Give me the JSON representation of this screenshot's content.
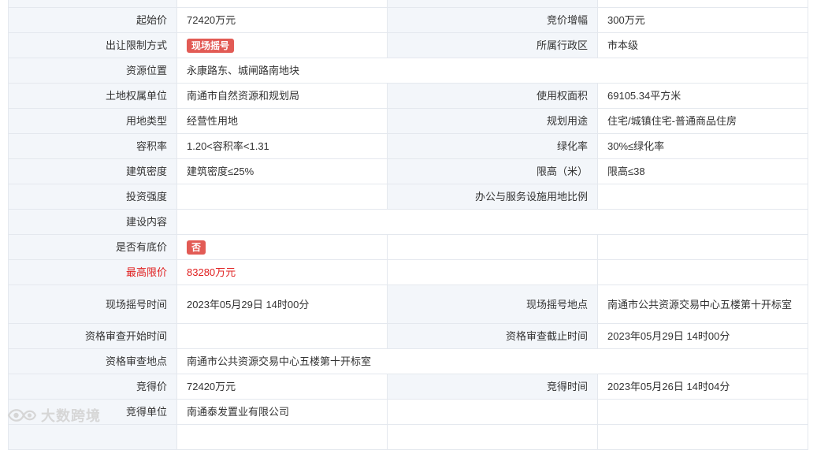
{
  "rows": [
    {
      "l1": "",
      "v1": "",
      "l2": "",
      "v2": ""
    },
    {
      "l1": "起始价",
      "v1": "72420万元",
      "l2": "竞价增幅",
      "v2": "300万元"
    },
    {
      "l1": "出让限制方式",
      "v1_tag": "现场摇号",
      "l2": "所属行政区",
      "v2": "市本级"
    },
    {
      "l1": "资源位置",
      "v1": "永康路东、城闸路南地块"
    },
    {
      "l1": "土地权属单位",
      "v1": "南通市自然资源和规划局",
      "l2": "使用权面积",
      "v2": "69105.34平方米"
    },
    {
      "l1": "用地类型",
      "v1": "经营性用地",
      "l2": "规划用途",
      "v2": "住宅/城镇住宅-普通商品住房"
    },
    {
      "l1": "容积率",
      "v1": "1.20<容积率<1.31",
      "l2": "绿化率",
      "v2": "30%≤绿化率"
    },
    {
      "l1": "建筑密度",
      "v1": "建筑密度≤25%",
      "l2": "限高（米）",
      "v2": "限高≤38"
    },
    {
      "l1": "投资强度",
      "v1": "",
      "l2": "办公与服务设施用地比例",
      "v2": ""
    },
    {
      "l1": "建设内容",
      "v1": ""
    },
    {
      "l1": "是否有底价",
      "v1_tag": "否",
      "l2": "",
      "v2": ""
    },
    {
      "l1": "最高限价",
      "v1": "83280万元",
      "l2": "",
      "v2": ""
    },
    {
      "l1": "现场摇号时间",
      "v1": "2023年05月29日 14时00分",
      "l2": "现场摇号地点",
      "v2": "南通市公共资源交易中心五楼第十开标室"
    },
    {
      "l1": "资格审查开始时间",
      "v1": "",
      "l2": "资格审查截止时间",
      "v2": "2023年05月29日 14时00分"
    },
    {
      "l1": "资格审查地点",
      "v1": "南通市公共资源交易中心五楼第十开标室"
    },
    {
      "l1": "竞得价",
      "v1": "72420万元",
      "l2": "竞得时间",
      "v2": "2023年05月26日 14时04分"
    },
    {
      "l1": "竞得单位",
      "v1": "南通泰发置业有限公司",
      "l2": "",
      "v2": ""
    },
    {
      "l1": "",
      "v1": "",
      "l2": "",
      "v2": ""
    }
  ],
  "colors": {
    "label_bg": "#f3f6fa",
    "border": "#e4e8ee",
    "tag_bg": "#e25b55",
    "highlight": "#e02020"
  },
  "watermark": {
    "text": "大数跨境",
    "icon": "eye-logo-icon"
  }
}
